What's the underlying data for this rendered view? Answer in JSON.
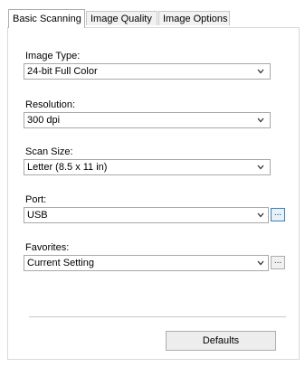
{
  "tabs": [
    {
      "label": "Basic Scanning",
      "active": true
    },
    {
      "label": "Image Quality",
      "active": false
    },
    {
      "label": "Image Options",
      "active": false
    }
  ],
  "fields": {
    "image_type": {
      "label": "Image Type:",
      "value": "24-bit Full Color"
    },
    "resolution": {
      "label": "Resolution:",
      "value": "300 dpi"
    },
    "scan_size": {
      "label": "Scan Size:",
      "value": "Letter (8.5 x 11 in)"
    },
    "port": {
      "label": "Port:",
      "value": "USB",
      "browse_label": "..."
    },
    "favorites": {
      "label": "Favorites:",
      "value": "Current Setting",
      "browse_label": "..."
    }
  },
  "buttons": {
    "defaults": "Defaults"
  },
  "icons": {
    "dropdown": "chevron-down-icon",
    "browse": "ellipsis-icon"
  }
}
